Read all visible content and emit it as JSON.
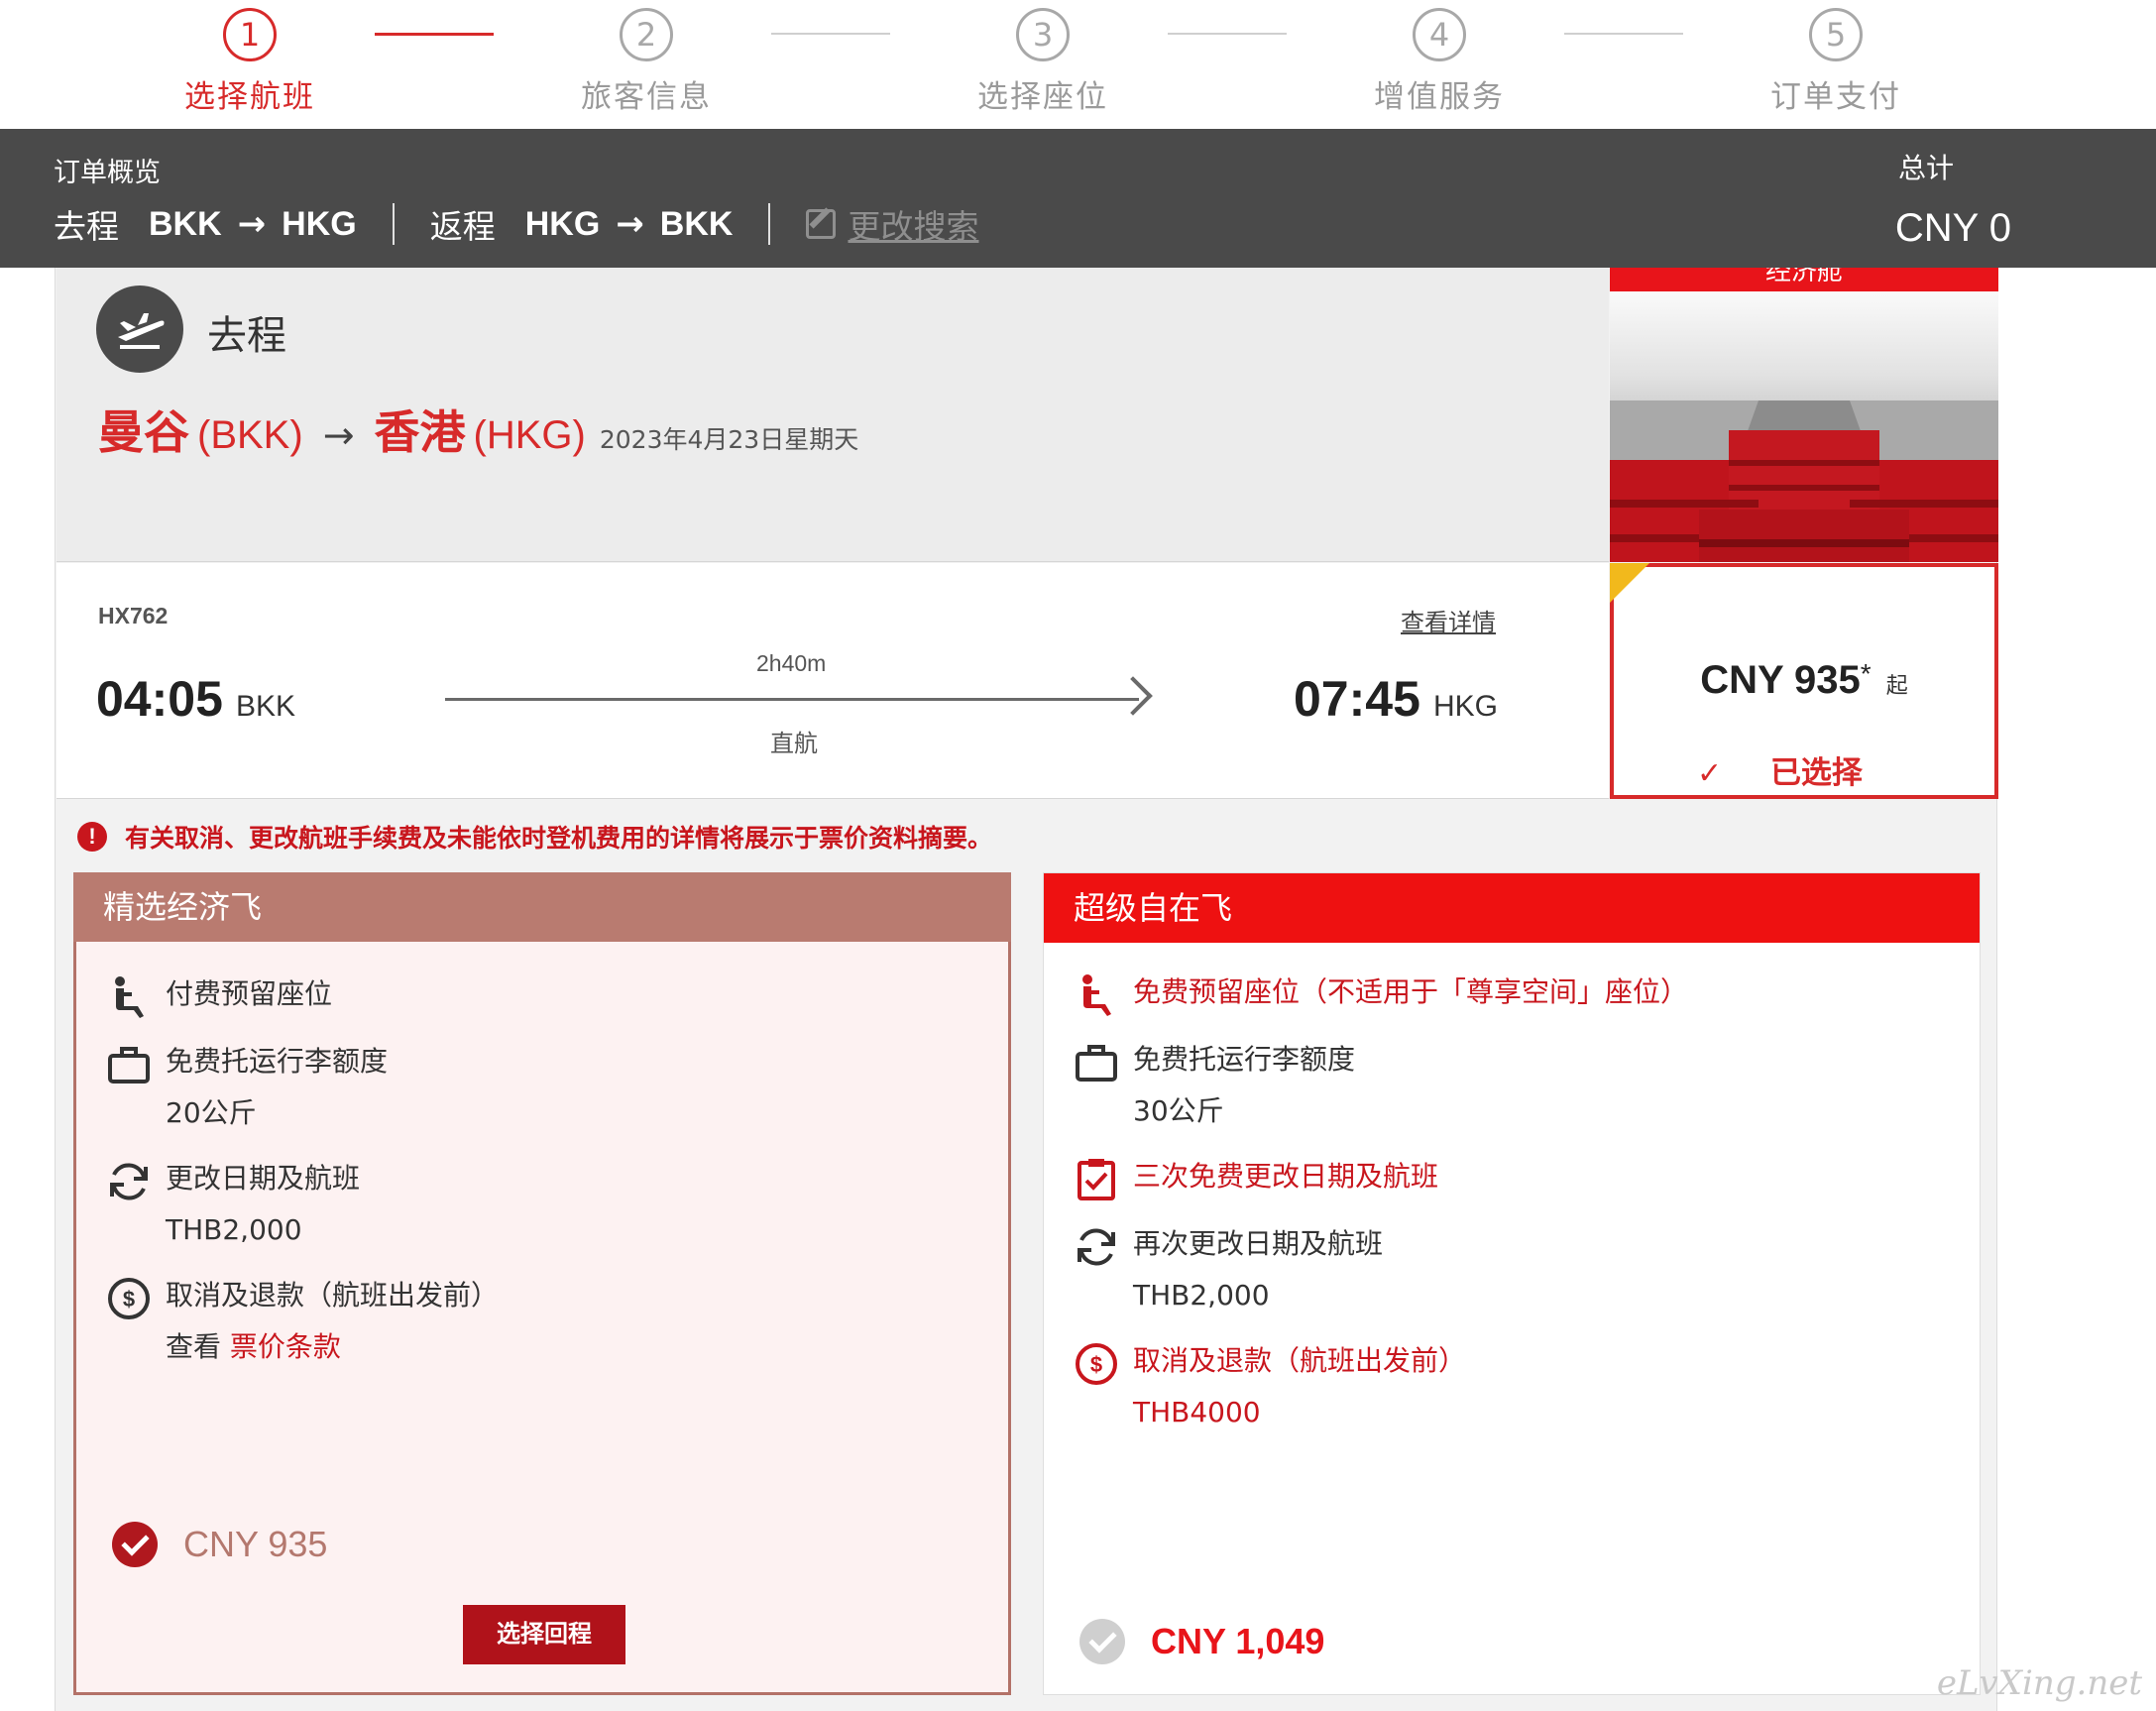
{
  "stepper": {
    "steps": [
      {
        "number": "1",
        "label": "选择航班"
      },
      {
        "number": "2",
        "label": "旅客信息"
      },
      {
        "number": "3",
        "label": "选择座位"
      },
      {
        "number": "4",
        "label": "增值服务"
      },
      {
        "number": "5",
        "label": "订单支付"
      }
    ],
    "active_step": 1,
    "active_color": "#d72a2a"
  },
  "summary": {
    "title": "订单概览",
    "outbound_label": "去程",
    "outbound_from": "BKK",
    "outbound_to": "HKG",
    "return_label": "返程",
    "return_from": "HKG",
    "return_to": "BKK",
    "edit_search": "更改搜索",
    "total_label": "总计",
    "total_value": "CNY 0"
  },
  "flight": {
    "direction_label": "去程",
    "origin_city": "曼谷",
    "origin_code": "(BKK)",
    "dest_city": "香港",
    "dest_code": "(HKG)",
    "date": "2023年4月23日星期天",
    "cabin_tag": "经济舱",
    "number": "HX762",
    "details_link": "查看详情",
    "dep_time": "04:05",
    "dep_code": "BKK",
    "arr_time": "07:45",
    "arr_code": "HKG",
    "duration": "2h40m",
    "stops": "直航",
    "price": "CNY 935",
    "price_star": "*",
    "price_from": "起",
    "selected_label": "已选择"
  },
  "notice": {
    "icon": "!",
    "text": "有关取消、更改航班手续费及未能依时登机费用的详情将展示于票价资料摘要。"
  },
  "fares": {
    "left": {
      "name": "精选经济飞",
      "seat": "付费预留座位",
      "baggage": "免费托运行李额度",
      "baggage_value": "20公斤",
      "change": "更改日期及航班",
      "change_value": "THB2,000",
      "refund": "取消及退款（航班出发前）",
      "refund_prefix": "查看 ",
      "refund_link": "票价条款",
      "price": "CNY 935",
      "button": "选择回程"
    },
    "right": {
      "name": "超级自在飞",
      "seat": "免费预留座位（不适用于「尊享空间」座位）",
      "baggage": "免费托运行李额度",
      "baggage_value": "30公斤",
      "free_change": "三次免费更改日期及航班",
      "change": "再次更改日期及航班",
      "change_value": "THB2,000",
      "refund": "取消及退款（航班出发前）",
      "refund_value": "THB4000",
      "price": "CNY 1,049"
    }
  },
  "watermark": "eLvXing.net",
  "colors": {
    "brand_red": "#d72a2a",
    "dark_bar": "#4a4a4a",
    "fare_left_header": "#b97b70",
    "fare_right_header": "#ee1111",
    "warning_yellow": "#f2b91c"
  }
}
